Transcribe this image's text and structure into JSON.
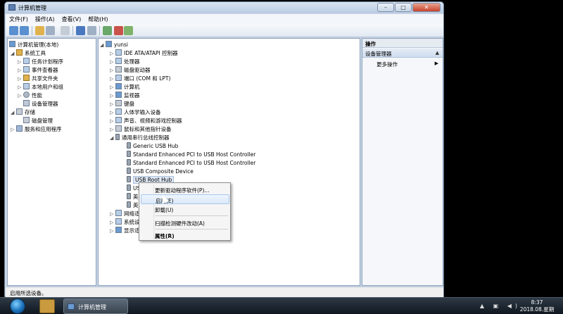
{
  "window": {
    "title": "计算机管理",
    "minimize": "–",
    "maximize": "□",
    "close": "✕"
  },
  "menu": [
    "文件(F)",
    "操作(A)",
    "查看(V)",
    "帮助(H)"
  ],
  "left_tree": {
    "root": "计算机管理(本地)",
    "system_tools": "系统工具",
    "task_scheduler": "任务计划程序",
    "event_viewer": "事件查看器",
    "shared_folders": "共享文件夹",
    "local_users": "本地用户和组",
    "performance": "性能",
    "device_manager": "设备管理器",
    "storage": "存储",
    "disk_management": "磁盘管理",
    "services_apps": "服务和应用程序"
  },
  "device_tree": {
    "computer_name": "yunsi",
    "categories": [
      "IDE ATA/ATAPI 控制器",
      "处理器",
      "磁盘驱动器",
      "端口 (COM 和 LPT)",
      "计算机",
      "监视器",
      "键盘",
      "人体学输入设备",
      "声音、视频和游戏控制器",
      "鼠标和其他指针设备",
      "通用串行总线控制器"
    ],
    "usb_children": [
      "Generic USB Hub",
      "Standard Enhanced PCI to USB Host Controller",
      "Standard Enhanced PCI to USB Host Controller",
      "USB Composite Device",
      "USB Root Hub",
      "US",
      "英",
      "英"
    ],
    "after": [
      "网络适",
      "系统设",
      "显示适"
    ]
  },
  "actions_pane": {
    "header": "操作",
    "section": "设备管理器",
    "more": "更多操作"
  },
  "context_menu": {
    "update_driver": "更新驱动程序软件(P)...",
    "enable": "启用(E)",
    "uninstall": "卸载(U)",
    "scan": "扫描检测硬件改动(A)",
    "properties": "属性(R)"
  },
  "status_bar": "启用所选设备。",
  "taskbar": {
    "task_label": "计算机管理",
    "time": "8:37",
    "date": "2018.08.星期二"
  }
}
